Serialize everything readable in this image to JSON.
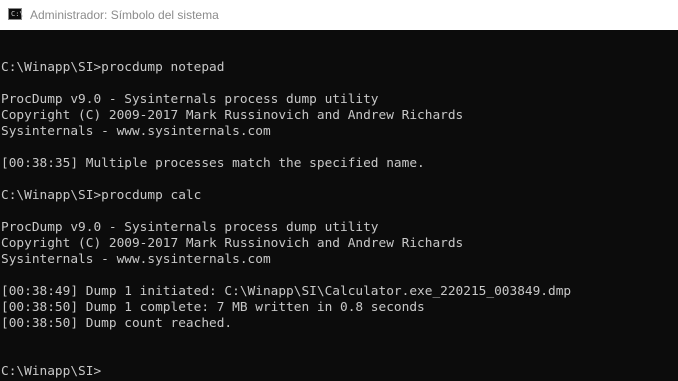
{
  "window": {
    "title": "Administrador: Símbolo del sistema",
    "icon": "cmd-icon",
    "icon_glyph": "C:\\"
  },
  "console": {
    "lines": [
      "",
      "C:\\Winapp\\SI>procdump notepad",
      "",
      "ProcDump v9.0 - Sysinternals process dump utility",
      "Copyright (C) 2009-2017 Mark Russinovich and Andrew Richards",
      "Sysinternals - www.sysinternals.com",
      "",
      "[00:38:35] Multiple processes match the specified name.",
      "",
      "C:\\Winapp\\SI>procdump calc",
      "",
      "ProcDump v9.0 - Sysinternals process dump utility",
      "Copyright (C) 2009-2017 Mark Russinovich and Andrew Richards",
      "Sysinternals - www.sysinternals.com",
      "",
      "[00:38:49] Dump 1 initiated: C:\\Winapp\\SI\\Calculator.exe_220215_003849.dmp",
      "[00:38:50] Dump 1 complete: 7 MB written in 0.8 seconds",
      "[00:38:50] Dump count reached.",
      "",
      "",
      "C:\\Winapp\\SI>"
    ]
  },
  "colors": {
    "console_background": "#0c0c0c",
    "console_text": "#c8c8c8",
    "titlebar_background": "#ffffff",
    "titlebar_text": "#8c8c8c"
  }
}
